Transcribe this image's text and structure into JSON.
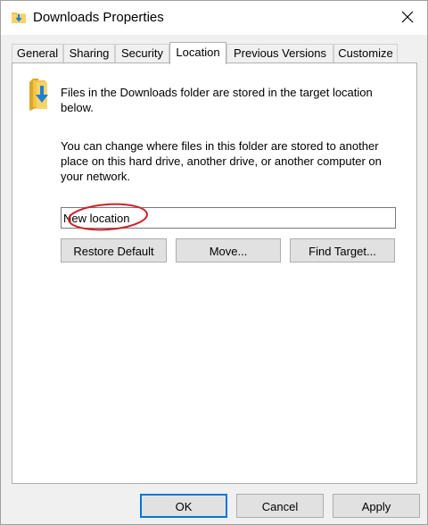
{
  "window": {
    "title": "Downloads Properties"
  },
  "tabs": [
    {
      "label": "General"
    },
    {
      "label": "Sharing"
    },
    {
      "label": "Security"
    },
    {
      "label": "Location",
      "active": true
    },
    {
      "label": "Previous Versions"
    },
    {
      "label": "Customize"
    }
  ],
  "location": {
    "info": "Files in the Downloads folder are stored in the target location below.",
    "description": "You can change where files in this folder are stored to another place on this hard drive, another drive, or another computer on your network.",
    "path_value": "New location",
    "restore_default_label": "Restore Default",
    "move_label": "Move...",
    "find_target_label": "Find Target..."
  },
  "footer": {
    "ok_label": "OK",
    "cancel_label": "Cancel",
    "apply_label": "Apply"
  },
  "colors": {
    "accent": "#0078d7",
    "annotation_circle": "#d0202a",
    "folder": "#f5c542",
    "arrow": "#1e7fd8"
  }
}
